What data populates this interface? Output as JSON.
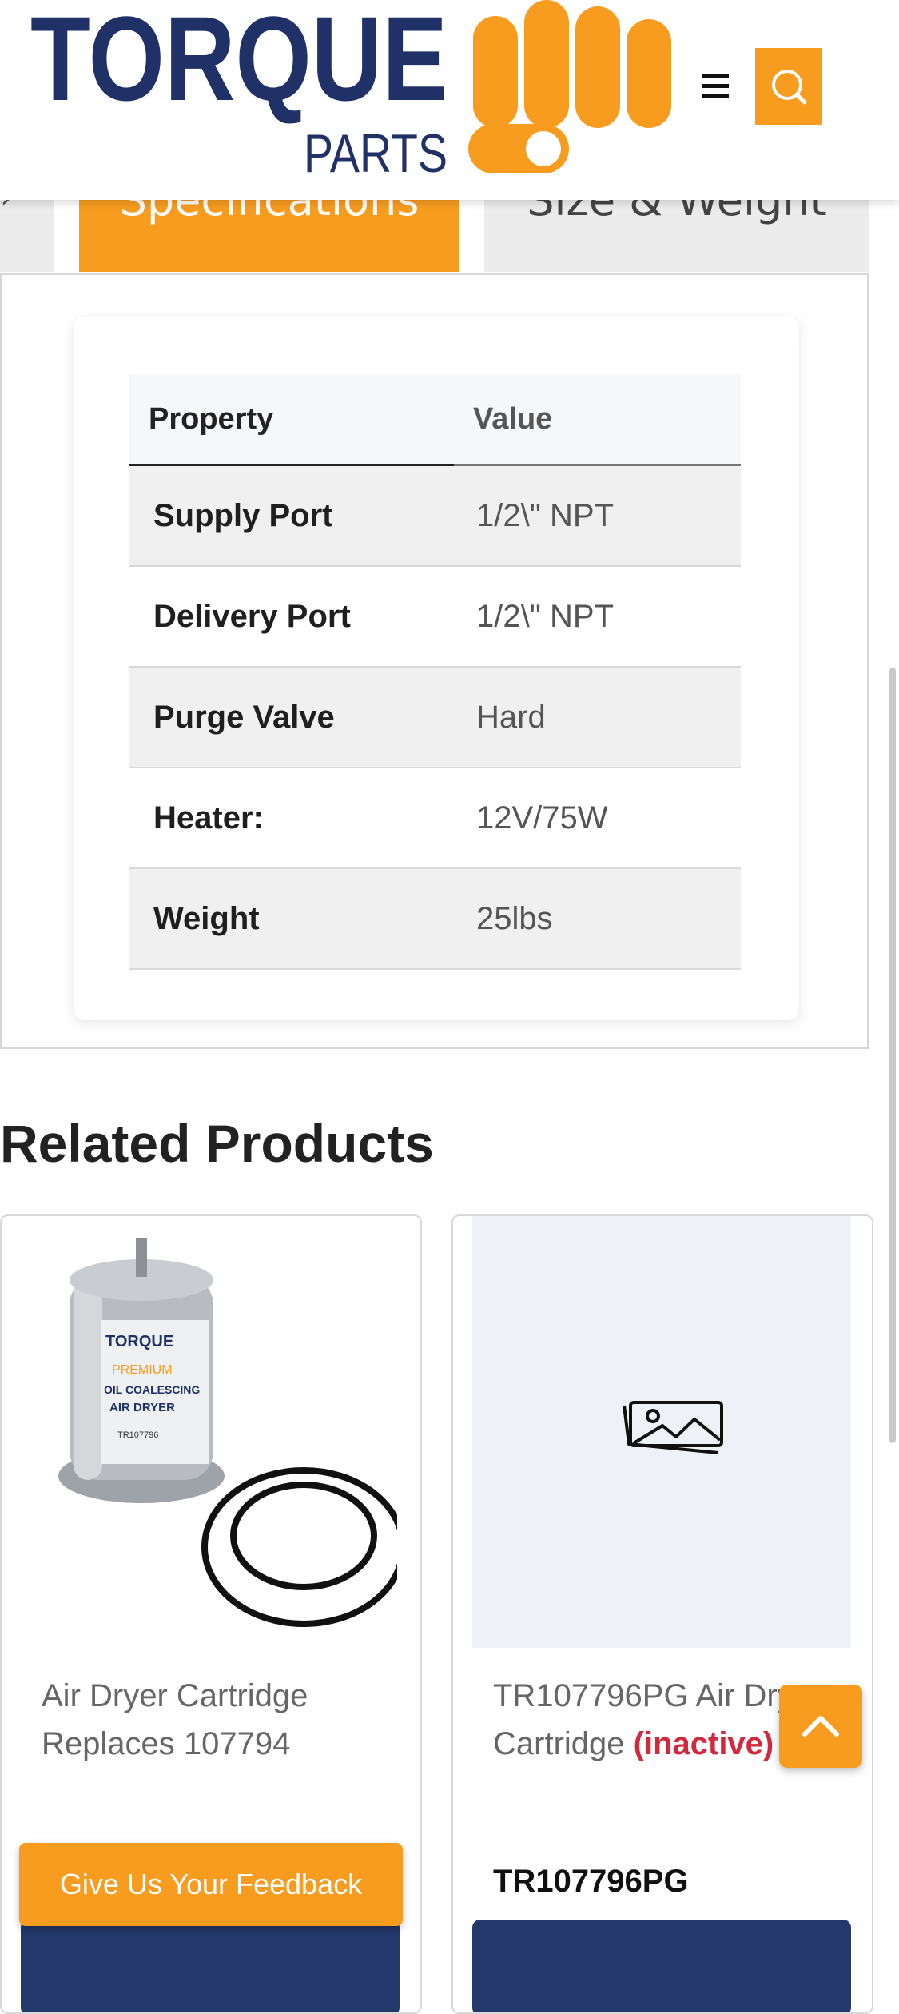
{
  "header": {
    "logo_text_main": "TORQUE",
    "logo_text_sub": "PARTS",
    "menu_icon": "hamburger-menu-icon",
    "search_icon": "search-icon"
  },
  "tabs": [
    {
      "label": "Specifications",
      "active": true
    },
    {
      "label": "Size & Weight",
      "active": false
    }
  ],
  "spec_table": {
    "headers": [
      "Property",
      "Value"
    ],
    "rows": [
      {
        "property": "Supply Port",
        "value": "1/2\\\" NPT"
      },
      {
        "property": "Delivery Port",
        "value": "1/2\\\" NPT"
      },
      {
        "property": "Purge Valve",
        "value": "Hard"
      },
      {
        "property": "Heater:",
        "value": "12V/75W"
      },
      {
        "property": "Weight",
        "value": "25lbs"
      }
    ]
  },
  "related": {
    "title": "Related Products",
    "products": [
      {
        "name": "Air Dryer Cartridge Replaces 107794",
        "image_label_brand": "TORQUE",
        "image_label_line1": "PREMIUM",
        "image_label_line2": "OIL COALESCING",
        "image_label_line3": "AIR DRYER",
        "image_label_part": "TR107796"
      },
      {
        "name": "TR107796PG Air Dryer Cartridge",
        "status": "(inactive)",
        "sku": "TR107796PG",
        "image_placeholder_icon": "image-placeholder-icon"
      }
    ]
  },
  "feedback_button": "Give Us Your Feedback",
  "back_to_top_icon": "chevron-up-icon",
  "colors": {
    "brand_navy": "#1f3166",
    "brand_orange": "#f79c1f",
    "inactive_red": "#d2293d"
  }
}
